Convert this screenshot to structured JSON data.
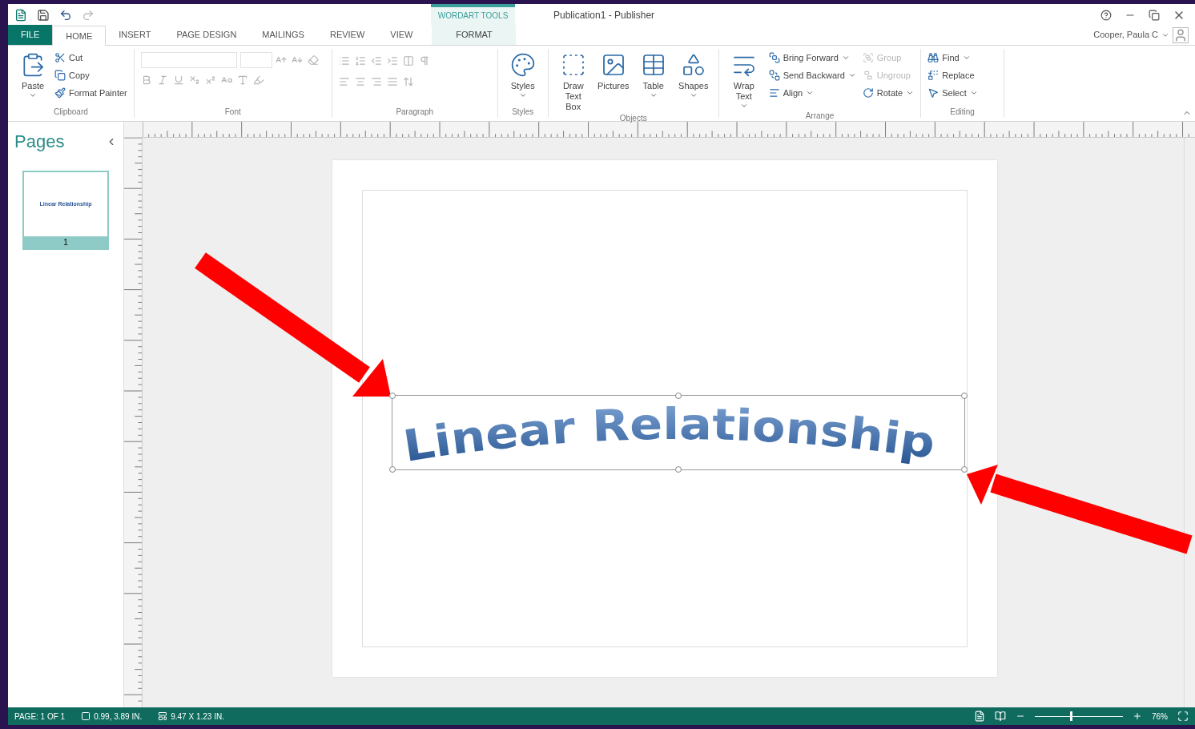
{
  "window": {
    "title": "Publication1 - Publisher",
    "contextual_tab_group": "WORDART TOOLS",
    "user": "Cooper, Paula C"
  },
  "tabs": [
    {
      "label": "FILE",
      "kind": "file",
      "selected": false
    },
    {
      "label": "HOME",
      "kind": "tab",
      "selected": true
    },
    {
      "label": "INSERT",
      "kind": "tab",
      "selected": false
    },
    {
      "label": "PAGE DESIGN",
      "kind": "tab",
      "selected": false
    },
    {
      "label": "MAILINGS",
      "kind": "tab",
      "selected": false
    },
    {
      "label": "REVIEW",
      "kind": "tab",
      "selected": false
    },
    {
      "label": "VIEW",
      "kind": "tab",
      "selected": false
    },
    {
      "label": "FORMAT",
      "kind": "contextual",
      "selected": false
    }
  ],
  "ribbon": [
    {
      "name": "Clipboard",
      "kind": "clipboard",
      "items": [
        {
          "label": "Paste",
          "kind": "large",
          "dropdown": true,
          "disabled": false
        },
        {
          "label": "Cut",
          "kind": "small",
          "dropdown": false,
          "disabled": false
        },
        {
          "label": "Copy",
          "kind": "small",
          "dropdown": false,
          "disabled": false
        },
        {
          "label": "Format Painter",
          "kind": "small",
          "dropdown": false,
          "disabled": false
        }
      ]
    },
    {
      "name": "Font",
      "kind": "font"
    },
    {
      "name": "Paragraph",
      "kind": "paragraph"
    },
    {
      "name": "Styles",
      "kind": "buttons",
      "items": [
        {
          "label": "Styles",
          "kind": "large",
          "dropdown": true,
          "disabled": false
        }
      ]
    },
    {
      "name": "Objects",
      "kind": "buttons",
      "items": [
        {
          "label": "Draw Text Box",
          "kind": "large",
          "dropdown": false,
          "disabled": false
        },
        {
          "label": "Pictures",
          "kind": "large",
          "dropdown": false,
          "disabled": false
        },
        {
          "label": "Table",
          "kind": "large",
          "dropdown": true,
          "disabled": false
        },
        {
          "label": "Shapes",
          "kind": "large",
          "dropdown": true,
          "disabled": false
        }
      ]
    },
    {
      "name": "Arrange",
      "kind": "arrange",
      "items": [
        {
          "label": "Wrap Text",
          "kind": "large",
          "dropdown": true,
          "disabled": false
        },
        {
          "label": "Bring Forward",
          "kind": "small",
          "dropdown": true,
          "disabled": false
        },
        {
          "label": "Send Backward",
          "kind": "small",
          "dropdown": true,
          "disabled": false
        },
        {
          "label": "Align",
          "kind": "small",
          "dropdown": true,
          "disabled": false
        },
        {
          "label": "Group",
          "kind": "small",
          "dropdown": false,
          "disabled": true
        },
        {
          "label": "Ungroup",
          "kind": "small",
          "dropdown": false,
          "disabled": true
        },
        {
          "label": "Rotate",
          "kind": "small",
          "dropdown": true,
          "disabled": false
        }
      ]
    },
    {
      "name": "Editing",
      "kind": "buttons",
      "items": [
        {
          "label": "Find",
          "kind": "small",
          "dropdown": true,
          "disabled": false
        },
        {
          "label": "Replace",
          "kind": "small",
          "dropdown": false,
          "disabled": false
        },
        {
          "label": "Select",
          "kind": "small",
          "dropdown": true,
          "disabled": false
        }
      ]
    }
  ],
  "pages_panel": {
    "title": "Pages",
    "pages": [
      {
        "number": "1",
        "thumbnail_text": "Linear Relationship",
        "selected": true
      }
    ]
  },
  "document": {
    "wordart": "Linear Relationship",
    "selected": true
  },
  "status_bar": {
    "page": "PAGE: 1 OF 1",
    "position": "0.99, 3.89 IN.",
    "size": "9.47 X 1.23 IN.",
    "zoom": {
      "level": 0.4,
      "reading": "76%"
    }
  }
}
